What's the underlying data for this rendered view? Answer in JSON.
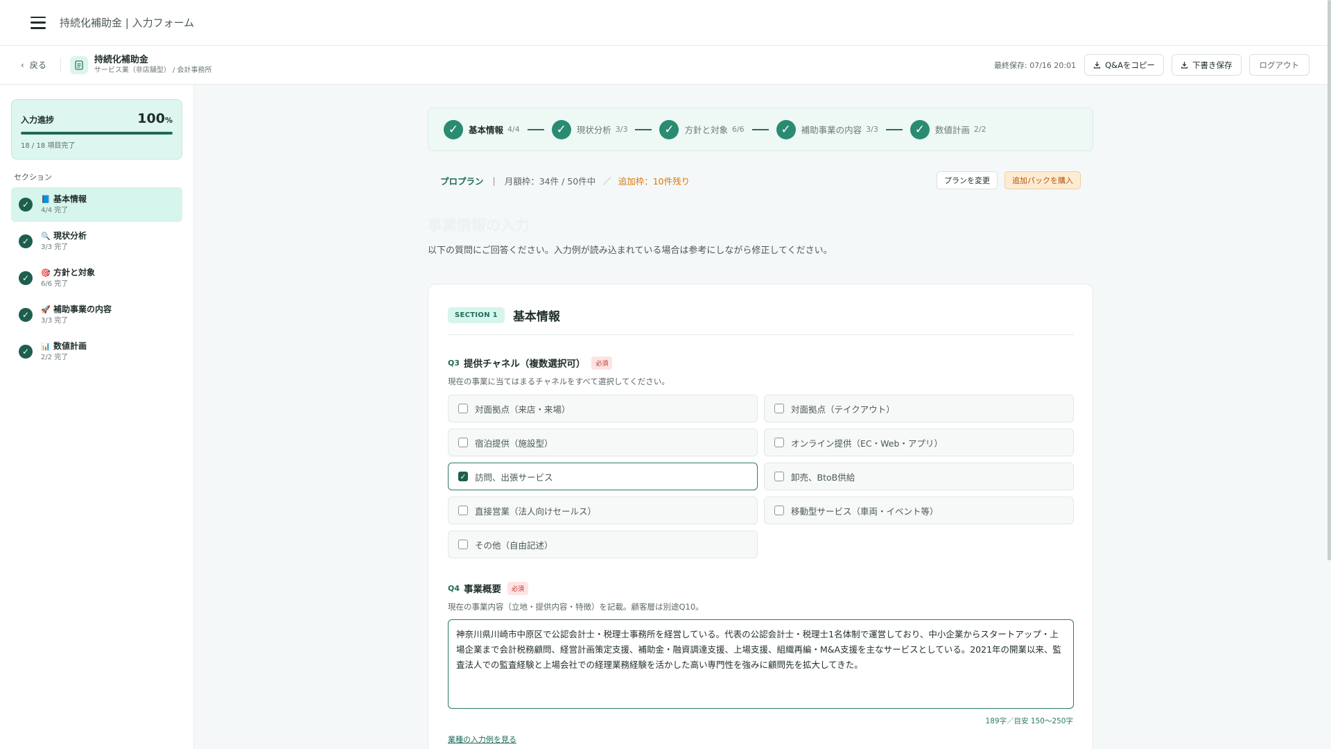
{
  "app": {
    "title": "持続化補助金 | 入力フォーム"
  },
  "subheader": {
    "back_label": "戻る",
    "doc_title": "持続化補助金",
    "doc_subtitle": "サービス業（非店舗型） / 会計事務所",
    "last_saved": "最終保存: 07/16 20:01",
    "copy_qa_label": "Q&Aをコピー",
    "save_draft_label": "下書き保存",
    "logout_label": "ログアウト"
  },
  "sidebar": {
    "progress_label": "入力進捗",
    "progress_percent": "100",
    "progress_unit": "%",
    "progress_fraction": 1.0,
    "progress_count": "18 / 18 項目完了",
    "section_heading": "セクション",
    "items": [
      {
        "icon": "book-icon",
        "glyph": "📘",
        "title": "基本情報",
        "sub": "4/4 完了",
        "active": true
      },
      {
        "icon": "magnifier-icon",
        "glyph": "🔍",
        "title": "現状分析",
        "sub": "3/3 完了",
        "active": false
      },
      {
        "icon": "target-icon",
        "glyph": "🎯",
        "title": "方針と対象",
        "sub": "6/6 完了",
        "active": false
      },
      {
        "icon": "rocket-icon",
        "glyph": "🚀",
        "title": "補助事業の内容",
        "sub": "3/3 完了",
        "active": false
      },
      {
        "icon": "bar-chart-icon",
        "glyph": "📊",
        "title": "数値計画",
        "sub": "2/2 完了",
        "active": false
      }
    ]
  },
  "stepper": {
    "steps": [
      {
        "label": "基本情報",
        "count": "4/4",
        "active": true
      },
      {
        "label": "現状分析",
        "count": "3/3",
        "active": false
      },
      {
        "label": "方針と対象",
        "count": "6/6",
        "active": false
      },
      {
        "label": "補助事業の内容",
        "count": "3/3",
        "active": false
      },
      {
        "label": "数値計画",
        "count": "2/2",
        "active": false
      }
    ]
  },
  "plan": {
    "name": "プロプラン",
    "separator": "|",
    "monthly": "月額枠：34件 / 50件中",
    "slash": "／",
    "extra": "追加枠：10件残り",
    "change_label": "プランを変更",
    "buy_label": "追加パックを購入"
  },
  "main": {
    "faded_heading": "事業情報の入力",
    "intro": "以下の質問にご回答ください。入力例が読み込まれている場合は参考にしながら修正してください。"
  },
  "section": {
    "badge": "SECTION 1",
    "title": "基本情報"
  },
  "q3": {
    "num": "Q3",
    "text": "提供チャネル（複数選択可）",
    "required": "必須",
    "hint": "現在の事業に当てはまるチャネルをすべて選択してください。",
    "options": [
      {
        "label": "対面拠点（来店・来場）",
        "checked": false
      },
      {
        "label": "対面拠点（テイクアウト）",
        "checked": false
      },
      {
        "label": "宿泊提供（施設型）",
        "checked": false
      },
      {
        "label": "オンライン提供（EC・Web・アプリ）",
        "checked": false
      },
      {
        "label": "訪問、出張サービス",
        "checked": true
      },
      {
        "label": "卸売、BtoB供給",
        "checked": false
      },
      {
        "label": "直接営業（法人向けセールス）",
        "checked": false
      },
      {
        "label": "移動型サービス（車両・イベント等）",
        "checked": false
      },
      {
        "label": "その他（自由記述）",
        "checked": false
      }
    ]
  },
  "q4": {
    "num": "Q4",
    "text": "事業概要",
    "required": "必須",
    "hint": "現在の事業内容（立地・提供内容・特徴）を記載。顧客層は別途Q10。",
    "value": "神奈川県川崎市中原区で公認会計士・税理士事務所を経営している。代表の公認会計士・税理士1名体制で運営しており、中小企業からスタートアップ・上場企業まで会計税務顧問、経営計画策定支援、補助金・融資調達支援、上場支援、組織再編・M&A支援を主なサービスとしている。2021年の開業以来、監査法人での監査経験と上場会社での経理業務経験を活かした高い専門性を強みに顧問先を拡大してきた。",
    "counter": "189字／目安 150〜250字",
    "example_link": "業種の入力例を見る"
  },
  "colors": {
    "accent": "#1e6a58",
    "step_circle": "#2a8b72",
    "active_bg": "#d6f5ec",
    "warning": "#d97706",
    "required": "#c53030"
  }
}
